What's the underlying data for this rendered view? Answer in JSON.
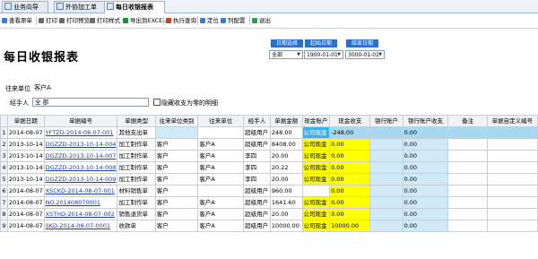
{
  "tabs": [
    {
      "label": "业务向导",
      "active": false
    },
    {
      "label": "外协加工单",
      "active": false
    },
    {
      "label": "每日收银报表",
      "active": true
    }
  ],
  "toolbar": [
    {
      "label": "查看原单",
      "color": "#3a7bd5"
    },
    {
      "label": "打印",
      "color": "#555555"
    },
    {
      "label": "打印预览",
      "color": "#555555"
    },
    {
      "label": "打印样式",
      "color": "#555555"
    },
    {
      "label": "导出到EXCEL",
      "color": "#1f8f3a"
    },
    {
      "label": "执行查询",
      "color": "#d04020"
    },
    {
      "label": "定位",
      "color": "#3a7bd5"
    },
    {
      "label": "列配置",
      "color": "#3a7bd5"
    },
    {
      "label": "退出",
      "color": "#2aa14a"
    }
  ],
  "page_title": "每日收银报表",
  "filters": {
    "date_choice_label": "日期选择",
    "date_choice_value": "全部",
    "start_label": "起始日期",
    "start_value": "1900-01-01",
    "end_label": "结束日期",
    "end_value": "3000-01-01"
  },
  "form": {
    "unit_label": "往来单位",
    "unit_value": "客户A",
    "handler_label": "经手人",
    "handler_value": "全 部",
    "hide_zero_label": "隐藏收支为零的明细"
  },
  "columns": [
    "",
    "单据日期",
    "单据编号",
    "单据类型",
    "往来单位类别",
    "往来单位",
    "经手人",
    "单据金额",
    "现金账户",
    "现金收支",
    "银行账户",
    "银行账户收支",
    "备注",
    "单据自定义编号"
  ],
  "rows": [
    [
      "1",
      "2014-08-07",
      "YFTZD-2014-08-07-001",
      "其他支出单",
      "",
      "",
      "超级用户",
      "248.00",
      "公司现金",
      "-248.00",
      "",
      "0.00",
      "",
      ""
    ],
    [
      "2",
      "2013-10-14",
      "DGZZD-2013-10-14-004",
      "加工制作单",
      "客户",
      "客户A",
      "超级用户",
      "8408.00",
      "公司现金",
      "0.00",
      "",
      "0.00",
      "",
      ""
    ],
    [
      "3",
      "2013-10-14",
      "DGZZD-2013-10-14-007",
      "加工制作单",
      "客户",
      "客户A",
      "李四",
      "20.00",
      "公司现金",
      "0.00",
      "",
      "0.00",
      "",
      ""
    ],
    [
      "4",
      "2013-10-14",
      "DGZZD-2013-10-14-008",
      "加工制作单",
      "客户",
      "客户A",
      "李四",
      "20.22",
      "公司现金",
      "0.00",
      "",
      "0.00",
      "",
      ""
    ],
    [
      "5",
      "2013-10-14",
      "DGZZD-2013-10-14-009",
      "加工制作单",
      "客户",
      "客户A",
      "李四",
      "20.00",
      "公司现金",
      "0.00",
      "",
      "0.00",
      "",
      ""
    ],
    [
      "6",
      "2014-08-07",
      "XSCKD-2014-08-07-001",
      "材料销售单",
      "客户",
      "",
      "超级用户",
      "960.00",
      "",
      "0.00",
      "",
      "0.00",
      "",
      ""
    ],
    [
      "7",
      "2014-08-07",
      "NO.201408070001",
      "加工制作单",
      "客户",
      "客户A",
      "超级用户",
      "1641.60",
      "公司现金",
      "0.00",
      "",
      "0.00",
      "",
      ""
    ],
    [
      "8",
      "2014-08-07",
      "XSTHD-2014-08-07-002",
      "销售退货单",
      "客户",
      "客户A",
      "超级用户",
      "20.00",
      "公司现金",
      "0.00",
      "",
      "0.00",
      "",
      ""
    ],
    [
      "9",
      "2014-08-07",
      "SKD-2014-08-07-0001",
      "收款单",
      "客户",
      "客户A",
      "超级用户",
      "10000.00",
      "公司现金",
      "10000.00",
      "",
      "0.00",
      "",
      ""
    ]
  ]
}
